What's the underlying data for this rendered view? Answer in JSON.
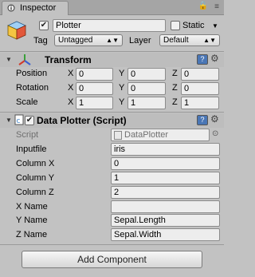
{
  "tab": {
    "title": "Inspector",
    "icon": "inspector-icon"
  },
  "object": {
    "active": true,
    "name": "Plotter",
    "static_label": "Static",
    "tag_label": "Tag",
    "tag_value": "Untagged",
    "layer_label": "Layer",
    "layer_value": "Default"
  },
  "transform": {
    "title": "Transform",
    "rows": [
      {
        "label": "Position",
        "x": "0",
        "y": "0",
        "z": "0"
      },
      {
        "label": "Rotation",
        "x": "0",
        "y": "0",
        "z": "0"
      },
      {
        "label": "Scale",
        "x": "1",
        "y": "1",
        "z": "1"
      }
    ],
    "axis": {
      "x": "X",
      "y": "Y",
      "z": "Z"
    }
  },
  "script": {
    "title": "Data Plotter (Script)",
    "script_label": "Script",
    "script_value": "DataPlotter",
    "fields": [
      {
        "label": "Inputfile",
        "value": "iris"
      },
      {
        "label": "Column X",
        "value": "0"
      },
      {
        "label": "Column Y",
        "value": "1"
      },
      {
        "label": "Column Z",
        "value": "2"
      },
      {
        "label": "X Name",
        "value": ""
      },
      {
        "label": "Y Name",
        "value": "Sepal.Length"
      },
      {
        "label": "Z Name",
        "value": "Sepal.Width"
      }
    ]
  },
  "add_component_label": "Add Component",
  "colors": {
    "background": "#c2c2c2",
    "field": "#ededed",
    "accent": "#4a76b5"
  }
}
